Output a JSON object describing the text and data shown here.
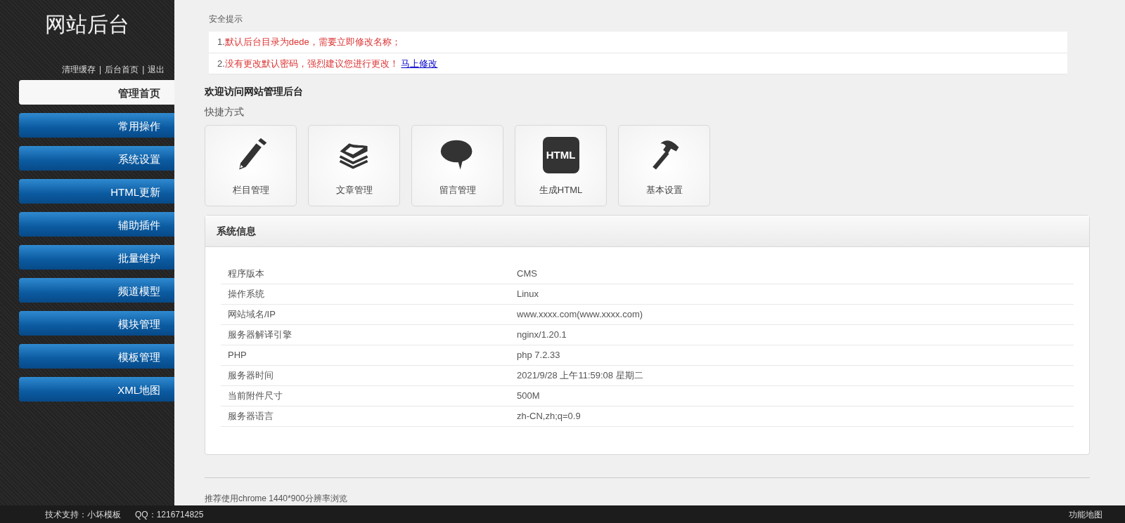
{
  "sidebar": {
    "title": "网站后台",
    "links": [
      "清理缓存",
      "后台首页",
      "退出"
    ],
    "separator": "|",
    "menu": [
      {
        "label": "管理首页",
        "selected": true
      },
      {
        "label": "常用操作",
        "selected": false
      },
      {
        "label": "系统设置",
        "selected": false
      },
      {
        "label": "HTML更新",
        "selected": false
      },
      {
        "label": "辅助插件",
        "selected": false
      },
      {
        "label": "批量维护",
        "selected": false
      },
      {
        "label": "频道模型",
        "selected": false
      },
      {
        "label": "模块管理",
        "selected": false
      },
      {
        "label": "模板管理",
        "selected": false
      },
      {
        "label": "XML地图",
        "selected": false
      }
    ]
  },
  "security": {
    "heading": "安全提示",
    "items": [
      {
        "number": "1.",
        "text": "默认后台目录为dede，需要立即修改名称；"
      },
      {
        "number": "2.",
        "text": "没有更改默认密码，强烈建议您进行更改！",
        "link": "马上修改"
      }
    ]
  },
  "welcome": "欢迎访问网站管理后台",
  "shortcuts_heading": "快捷方式",
  "shortcuts": [
    {
      "label": "栏目管理",
      "kind": "pencil"
    },
    {
      "label": "文章管理",
      "kind": "papers"
    },
    {
      "label": "留言管理",
      "kind": "bubble"
    },
    {
      "label": "生成HTML",
      "kind": "html",
      "icon_text": "HTML"
    },
    {
      "label": "基本设置",
      "kind": "hammer"
    }
  ],
  "system_info": {
    "title": "系统信息",
    "rows": [
      {
        "label": "程序版本",
        "value": "CMS"
      },
      {
        "label": "操作系统",
        "value": "Linux"
      },
      {
        "label": "网站域名/IP",
        "value": "www.xxxx.com(www.xxxx.com)"
      },
      {
        "label": "服务器解译引擎",
        "value": "nginx/1.20.1"
      },
      {
        "label": "PHP",
        "value": "php 7.2.33"
      },
      {
        "label": "服务器时间",
        "value": "2021/9/28 上午11:59:08 星期二"
      },
      {
        "label": "当前附件尺寸",
        "value": "500M"
      },
      {
        "label": "服务器语言",
        "value": "zh-CN,zh;q=0.9"
      }
    ]
  },
  "note": "推荐使用chrome 1440*900分辨率浏览",
  "status_bar": {
    "support": "技术支持：小坏模板",
    "qq": "QQ：1216714825",
    "sitemap": "功能地图"
  }
}
